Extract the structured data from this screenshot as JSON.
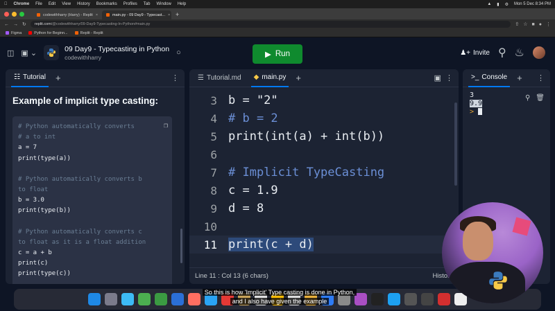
{
  "menubar": {
    "app": "Chrome",
    "items": [
      "File",
      "Edit",
      "View",
      "History",
      "Bookmarks",
      "Profiles",
      "Tab",
      "Window",
      "Help"
    ],
    "clock": "Mon 5 Dec 8:34 PM"
  },
  "browser": {
    "tabs": [
      {
        "label": "codewithharry (Harry) - Replit"
      },
      {
        "label": "main.py - 09 Day9 - Typecast..."
      }
    ],
    "url_host": "replit.com",
    "url_path": "/@codewithharry/09-Day9-Typecasting-In-Python#main.py",
    "bookmarks": [
      "Figma",
      "Python for Beginn...",
      "Replit - Replit"
    ]
  },
  "header": {
    "repl_title": "09 Day9 - Typecasting in Python",
    "owner": "codewithharry",
    "run_label": "Run",
    "invite_label": "Invite"
  },
  "tutorial": {
    "tab_label": "Tutorial",
    "heading": "Example of implicit type casting:",
    "code": [
      {
        "t": "cm",
        "s": "# Python automatically converts"
      },
      {
        "t": "cm",
        "s": "# a to int"
      },
      {
        "t": "cd",
        "s": "a = 7"
      },
      {
        "t": "cd",
        "s": "print(type(a))"
      },
      {
        "t": "gap",
        "s": ""
      },
      {
        "t": "cm",
        "s": "# Python automatically converts b"
      },
      {
        "t": "cm",
        "s": "to float"
      },
      {
        "t": "cd",
        "s": "b = 3.0"
      },
      {
        "t": "cd",
        "s": "print(type(b))"
      },
      {
        "t": "gap",
        "s": ""
      },
      {
        "t": "cm",
        "s": "# Python automatically converts c"
      },
      {
        "t": "cm",
        "s": "to float as it is a float addition"
      },
      {
        "t": "cd",
        "s": "c = a + b"
      },
      {
        "t": "cd",
        "s": "print(c)"
      },
      {
        "t": "cd",
        "s": "print(type(c))"
      }
    ]
  },
  "editor": {
    "tabs": [
      {
        "label": "Tutorial.md",
        "active": false
      },
      {
        "label": "main.py",
        "active": true
      }
    ],
    "lines": [
      {
        "n": "3",
        "text": "b = \"2\"",
        "kind": "code"
      },
      {
        "n": "4",
        "text": "# b = 2",
        "kind": "comment"
      },
      {
        "n": "5",
        "text": "print(int(a) + int(b))",
        "kind": "code"
      },
      {
        "n": "6",
        "text": "",
        "kind": "code"
      },
      {
        "n": "7",
        "text": "# Implicit TypeCasting",
        "kind": "comment"
      },
      {
        "n": "8",
        "text": "c = 1.9",
        "kind": "code"
      },
      {
        "n": "9",
        "text": "d = 8",
        "kind": "code"
      },
      {
        "n": "10",
        "text": "",
        "kind": "code"
      },
      {
        "n": "11",
        "text": "print(c + d)",
        "kind": "current"
      }
    ],
    "status": "Line 11 : Col 13 (6 chars)",
    "history_label": "History"
  },
  "console": {
    "tab_label": "Console",
    "output": [
      "3",
      "9.9"
    ],
    "prompt": ">"
  },
  "caption": {
    "line1": "So this is how 'Implicit' Type casting is done in Python,",
    "line2": "and I also have given the example"
  },
  "colors": {
    "run_green": "#0f8a2e",
    "bg": "#0e1525",
    "panel": "#1c2333",
    "accent": "#0079f2"
  }
}
